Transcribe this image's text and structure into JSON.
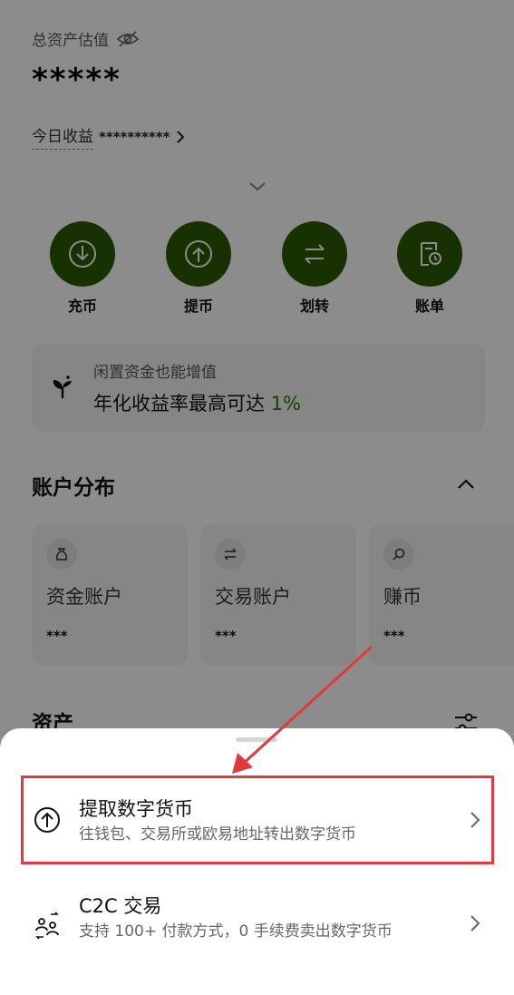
{
  "balance": {
    "total_label": "总资产估值",
    "total_value": "*****",
    "today_label": "今日收益",
    "today_value": "**********"
  },
  "actions": [
    {
      "label": "充币",
      "icon": "deposit-icon"
    },
    {
      "label": "提币",
      "icon": "withdraw-icon"
    },
    {
      "label": "划转",
      "icon": "transfer-icon"
    },
    {
      "label": "账单",
      "icon": "bill-icon"
    }
  ],
  "promo": {
    "line1": "闲置资金也能增值",
    "line2_prefix": "年化收益率最高可达",
    "line2_rate": "1%"
  },
  "accounts": {
    "title": "账户分布",
    "items": [
      {
        "name": "资金账户",
        "value": "***",
        "icon": "wallet-bag-icon"
      },
      {
        "name": "交易账户",
        "value": "***",
        "icon": "swap-icon"
      },
      {
        "name": "赚币",
        "value": "***",
        "icon": "coin-icon"
      }
    ]
  },
  "assets": {
    "title": "资产"
  },
  "sheet": {
    "options": [
      {
        "title": "提取数字货币",
        "subtitle": "往钱包、交易所或欧易地址转出数字货币",
        "icon": "withdraw-upload-icon"
      },
      {
        "title": "C2C 交易",
        "subtitle": "支持 100+ 付款方式，0 手续费卖出数字货币",
        "icon": "c2c-users-icon"
      }
    ]
  },
  "colors": {
    "action_green": "#2a5a00",
    "accent_green": "#1f7a00",
    "highlight_red": "#e0393e"
  }
}
